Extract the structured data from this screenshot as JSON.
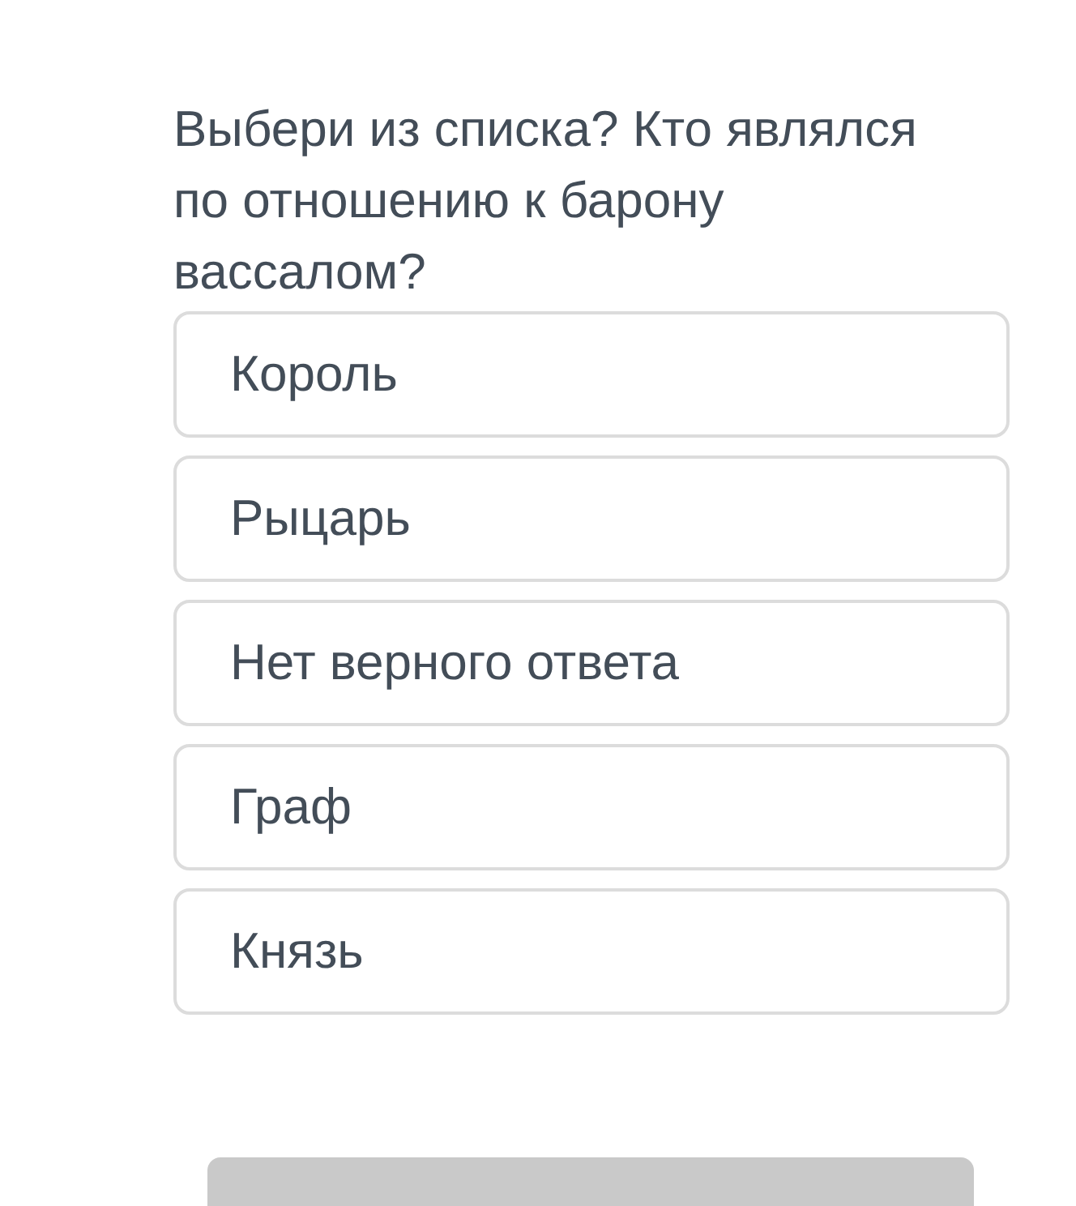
{
  "question": "Выбери из списка? Кто являлся по отношению к барону вассалом?",
  "options": [
    {
      "label": "Король"
    },
    {
      "label": "Рыцарь"
    },
    {
      "label": "Нет верного ответа"
    },
    {
      "label": "Граф"
    },
    {
      "label": "Князь"
    }
  ]
}
